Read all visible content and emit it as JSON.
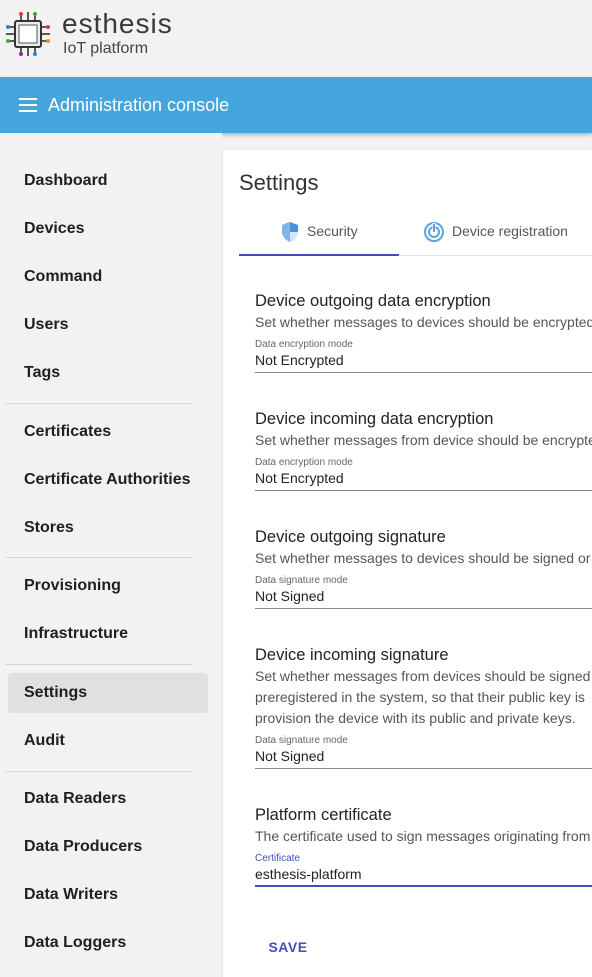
{
  "brand": {
    "name": "esthesis",
    "subtitle": "IoT platform",
    "logo_icon": "circuit-chip-icon"
  },
  "topbar": {
    "title": "Administration console",
    "menu_icon": "hamburger-menu-icon",
    "color": "#45a5dd"
  },
  "sidebar": {
    "items": [
      {
        "label": "Dashboard"
      },
      {
        "label": "Devices"
      },
      {
        "label": "Command"
      },
      {
        "label": "Users"
      },
      {
        "label": "Tags"
      },
      {
        "label": "Certificates"
      },
      {
        "label": "Certificate Authorities"
      },
      {
        "label": "Stores"
      },
      {
        "label": "Provisioning"
      },
      {
        "label": "Infrastructure"
      },
      {
        "label": "Settings",
        "active": true
      },
      {
        "label": "Audit"
      },
      {
        "label": "Data Readers"
      },
      {
        "label": "Data Producers"
      },
      {
        "label": "Data Writers"
      },
      {
        "label": "Data Loggers"
      }
    ]
  },
  "page": {
    "title": "Settings",
    "tabs": [
      {
        "label": "Security",
        "icon": "shield-icon",
        "selected": true
      },
      {
        "label": "Device registration",
        "icon": "registration-icon",
        "selected": false
      }
    ],
    "accent": "#3f51b5"
  },
  "sections": [
    {
      "title": "Device outgoing data encryption",
      "desc": [
        "Set whether messages to devices should be encrypted"
      ],
      "field_label": "Data encryption mode",
      "field_value": "Not Encrypted"
    },
    {
      "title": "Device incoming data encryption",
      "desc": [
        "Set whether messages from device should be encrypted"
      ],
      "field_label": "Data encryption mode",
      "field_value": "Not Encrypted"
    },
    {
      "title": "Device outgoing signature",
      "desc": [
        "Set whether messages to devices should be signed or"
      ],
      "field_label": "Data signature mode",
      "field_value": "Not Signed"
    },
    {
      "title": "Device incoming signature",
      "desc": [
        "Set whether messages from devices should be signed",
        "preregistered in the system, so that their public key is",
        "provision the device with its public and private keys."
      ],
      "field_label": "Data signature mode",
      "field_value": "Not Signed"
    },
    {
      "title": "Platform certificate",
      "desc": [
        "The certificate used to sign messages originating from"
      ],
      "field_label": "Certificate",
      "field_value": "esthesis-platform"
    }
  ],
  "actions": {
    "save_label": "SAVE"
  }
}
